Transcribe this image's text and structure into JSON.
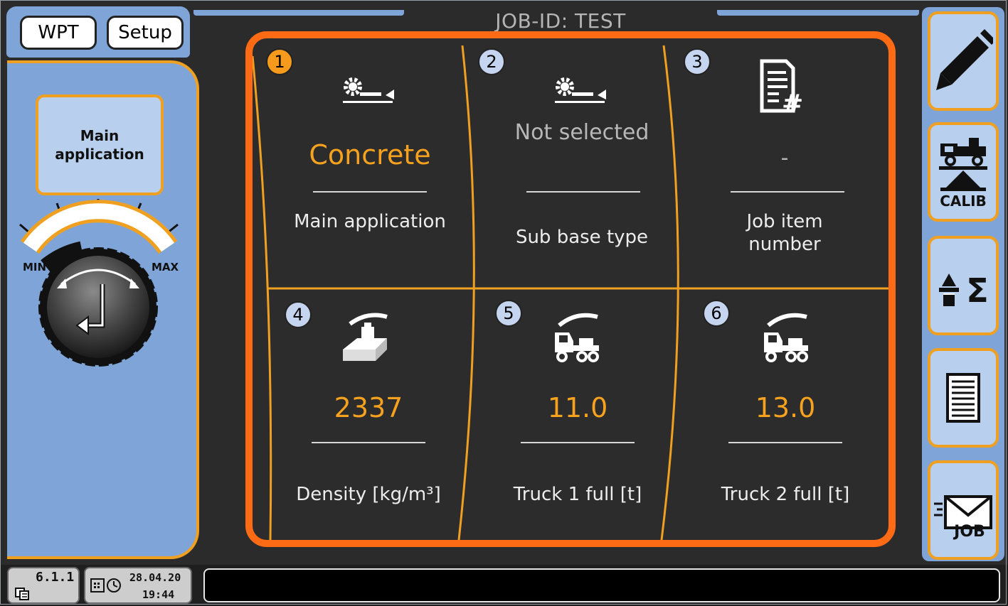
{
  "header": {
    "job_id": "JOB-ID: TEST",
    "buttons": [
      {
        "label": "WPT"
      },
      {
        "label": "Setup"
      }
    ]
  },
  "left_panel": {
    "main_application_button": "Main application",
    "gauge": {
      "min_label": "MIN",
      "max_label": "MAX",
      "level": 0.35
    }
  },
  "grid": {
    "cells": [
      {
        "number": "1",
        "value": "Concrete",
        "label": "Main application",
        "icon": "paver-screed-icon",
        "active": true
      },
      {
        "number": "2",
        "value": "Not selected",
        "label": "Sub base type",
        "icon": "paver-screed-icon",
        "active": false
      },
      {
        "number": "3",
        "value": "-",
        "label": "Job item number",
        "icon": "document-hash-icon",
        "active": false
      },
      {
        "number": "4",
        "value": "2337",
        "label": "Density [kg/m³]",
        "icon": "density-weight-icon",
        "active": false
      },
      {
        "number": "5",
        "value": "11.0",
        "label": "Truck 1 full  [t]",
        "icon": "truck-load-icon",
        "active": false
      },
      {
        "number": "6",
        "value": "13.0",
        "label": "Truck 2 full  [t]",
        "icon": "truck-load-icon",
        "active": false
      }
    ]
  },
  "toolbar": {
    "items": [
      {
        "name": "edit-pencil-icon"
      },
      {
        "name": "calib-icon",
        "label": "CALIB"
      },
      {
        "name": "sum-icon",
        "label": "Σ"
      },
      {
        "name": "report-list-icon"
      },
      {
        "name": "job-send-icon",
        "label": "JOB"
      }
    ]
  },
  "status_bar": {
    "version": "6.1.1",
    "date": "28.04.20",
    "time": "19:44",
    "message": ""
  },
  "colors": {
    "accent_orange": "#ff6a14",
    "value_orange": "#f6a21e",
    "panel_blue": "#7fa5d8",
    "background": "#2c2c2c"
  }
}
